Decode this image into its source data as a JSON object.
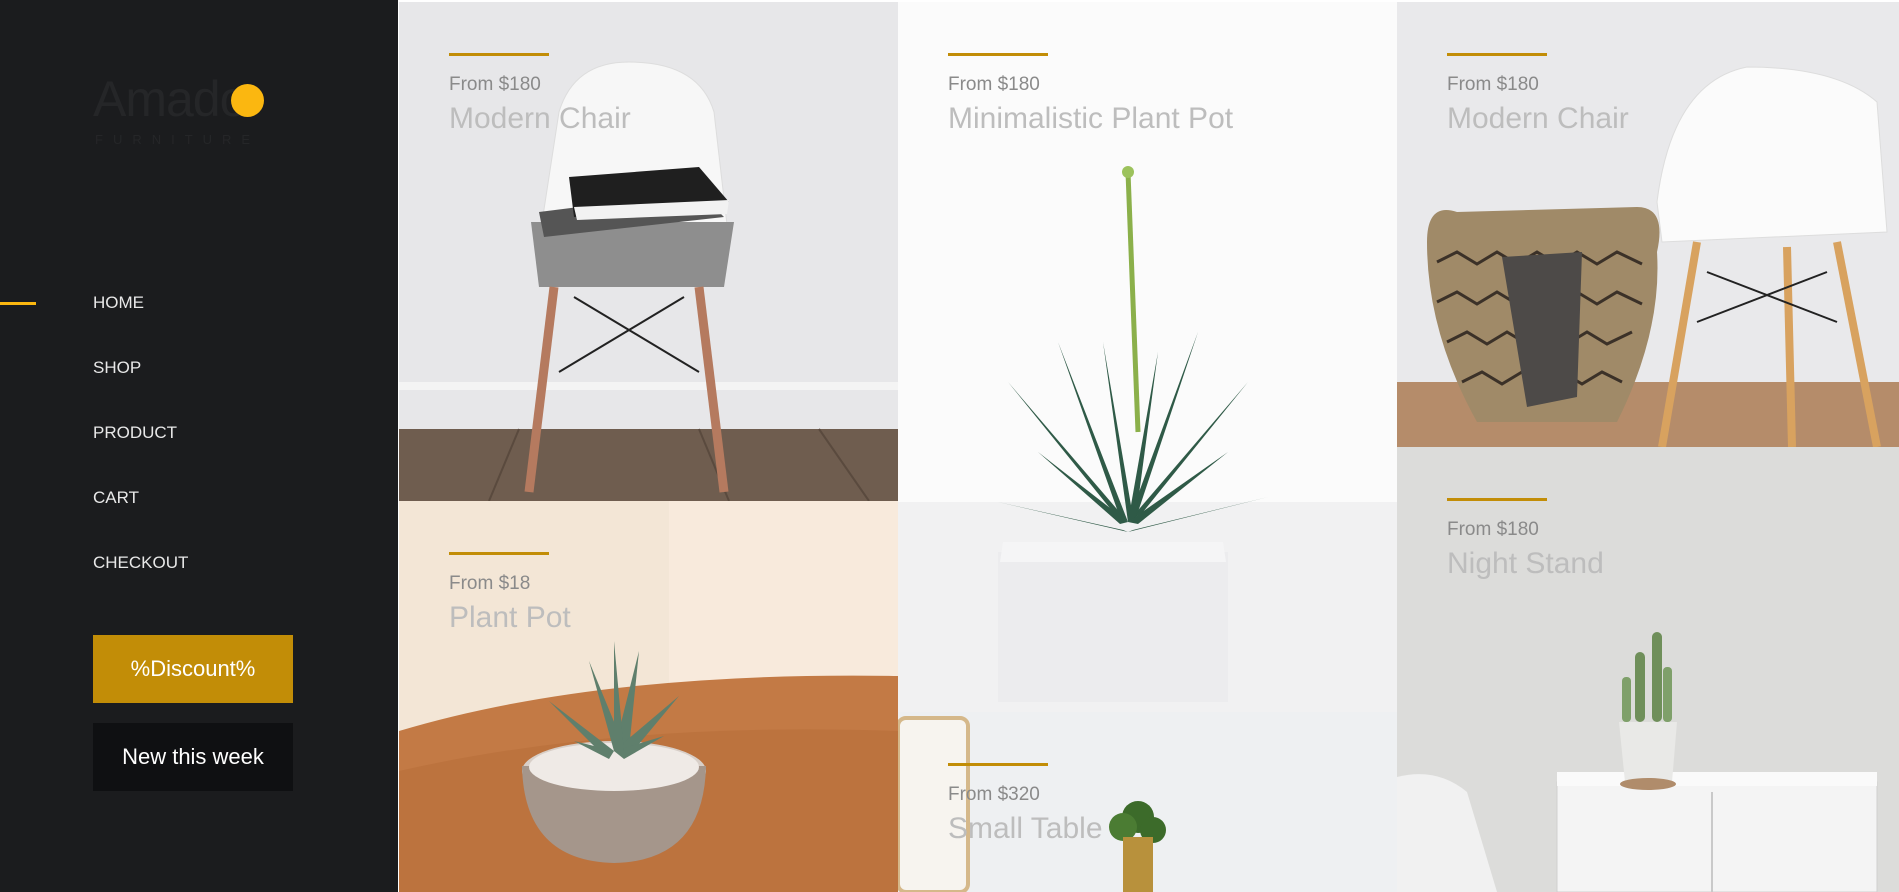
{
  "brand": {
    "name": "Amado",
    "tagline": "FURNITURE"
  },
  "nav": {
    "items": [
      {
        "label": "HOME",
        "active": true
      },
      {
        "label": "SHOP"
      },
      {
        "label": "PRODUCT"
      },
      {
        "label": "CART"
      },
      {
        "label": "CHECKOUT"
      }
    ]
  },
  "buttons": {
    "discount": "%Discount%",
    "new_week": "New this week"
  },
  "products": [
    {
      "price": "From $180",
      "name": "Modern Chair",
      "image": "white chair with sneakers and knit throw"
    },
    {
      "price": "From $18",
      "name": "Plant Pot",
      "image": "succulent in grey round pot on wooden table"
    },
    {
      "price": "From $180",
      "name": "Minimalistic Plant Pot",
      "image": "aloe plant in white square pot"
    },
    {
      "price": "From $320",
      "name": "Small Table",
      "image": "small plant in gold pot beside mirror"
    },
    {
      "price": "From $180",
      "name": "Modern Chair",
      "image": "white chair next to woven basket"
    },
    {
      "price": "From $180",
      "name": "Night Stand",
      "image": "cactus in white pot on white night stand"
    }
  ],
  "colors": {
    "sidebar": "#1b1c1e",
    "accent": "#c28d07",
    "logo_dot": "#fbb710",
    "dark_button": "#0f1012"
  }
}
